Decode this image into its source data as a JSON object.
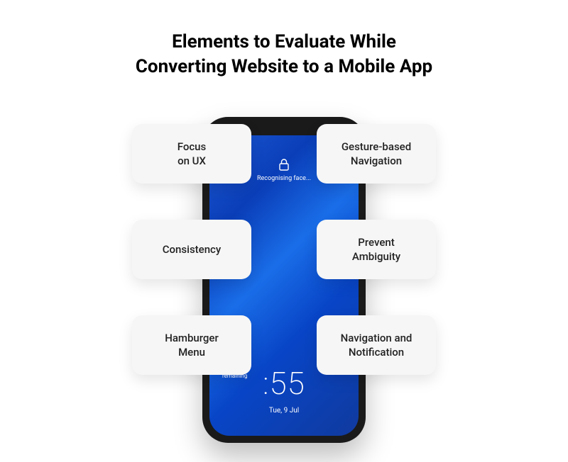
{
  "title_line1": "Elements to Evaluate While",
  "title_line2": "Converting Website to a Mobile App",
  "phone": {
    "lock_label": "Recognising face...",
    "time": ":55",
    "date": "Tue, 9 Jul",
    "remaining": "remaining"
  },
  "cards": [
    {
      "line1": "Focus",
      "line2": "on UX"
    },
    {
      "line1": "Gesture-based",
      "line2": "Navigation"
    },
    {
      "line1": "Consistency",
      "line2": ""
    },
    {
      "line1": "Prevent",
      "line2": "Ambiguity"
    },
    {
      "line1": "Hamburger",
      "line2": "Menu"
    },
    {
      "line1": "Navigation and",
      "line2": "Notification"
    }
  ]
}
